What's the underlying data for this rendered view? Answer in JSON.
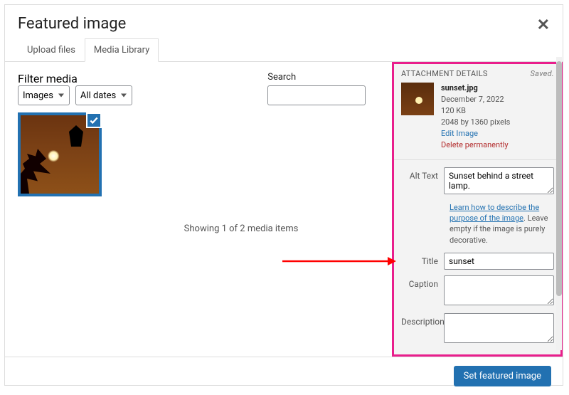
{
  "header": {
    "title": "Featured image"
  },
  "tabs": {
    "upload": "Upload files",
    "library": "Media Library",
    "active": "library"
  },
  "filters": {
    "media_label": "Filter media",
    "media_value": "Images",
    "dates_value": "All dates",
    "search_label": "Search"
  },
  "status": "Showing 1 of 2 media items",
  "attachment": {
    "heading": "ATTACHMENT DETAILS",
    "saved_label": "Saved.",
    "filename": "sunset.jpg",
    "date": "December 7, 2022",
    "size": "120 KB",
    "dimensions": "2048 by 1360 pixels",
    "edit_link": "Edit Image",
    "delete_link": "Delete permanently",
    "alt_label": "Alt Text",
    "alt_value": "Sunset behind a street lamp.",
    "alt_note_link": "Learn how to describe the purpose of the image",
    "alt_note_rest": ". Leave empty if the image is purely decorative.",
    "title_label": "Title",
    "title_value": "sunset",
    "caption_label": "Caption",
    "caption_value": "",
    "description_label": "Description",
    "description_value": ""
  },
  "footer": {
    "primary": "Set featured image"
  }
}
